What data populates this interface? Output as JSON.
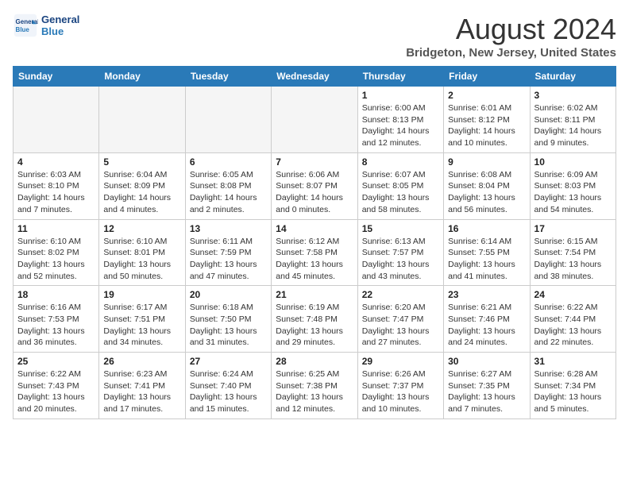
{
  "header": {
    "logo_line1": "General",
    "logo_line2": "Blue",
    "month_title": "August 2024",
    "location": "Bridgeton, New Jersey, United States"
  },
  "calendar": {
    "days_of_week": [
      "Sunday",
      "Monday",
      "Tuesday",
      "Wednesday",
      "Thursday",
      "Friday",
      "Saturday"
    ],
    "weeks": [
      [
        {
          "day": "",
          "info": ""
        },
        {
          "day": "",
          "info": ""
        },
        {
          "day": "",
          "info": ""
        },
        {
          "day": "",
          "info": ""
        },
        {
          "day": "1",
          "info": "Sunrise: 6:00 AM\nSunset: 8:13 PM\nDaylight: 14 hours\nand 12 minutes."
        },
        {
          "day": "2",
          "info": "Sunrise: 6:01 AM\nSunset: 8:12 PM\nDaylight: 14 hours\nand 10 minutes."
        },
        {
          "day": "3",
          "info": "Sunrise: 6:02 AM\nSunset: 8:11 PM\nDaylight: 14 hours\nand 9 minutes."
        }
      ],
      [
        {
          "day": "4",
          "info": "Sunrise: 6:03 AM\nSunset: 8:10 PM\nDaylight: 14 hours\nand 7 minutes."
        },
        {
          "day": "5",
          "info": "Sunrise: 6:04 AM\nSunset: 8:09 PM\nDaylight: 14 hours\nand 4 minutes."
        },
        {
          "day": "6",
          "info": "Sunrise: 6:05 AM\nSunset: 8:08 PM\nDaylight: 14 hours\nand 2 minutes."
        },
        {
          "day": "7",
          "info": "Sunrise: 6:06 AM\nSunset: 8:07 PM\nDaylight: 14 hours\nand 0 minutes."
        },
        {
          "day": "8",
          "info": "Sunrise: 6:07 AM\nSunset: 8:05 PM\nDaylight: 13 hours\nand 58 minutes."
        },
        {
          "day": "9",
          "info": "Sunrise: 6:08 AM\nSunset: 8:04 PM\nDaylight: 13 hours\nand 56 minutes."
        },
        {
          "day": "10",
          "info": "Sunrise: 6:09 AM\nSunset: 8:03 PM\nDaylight: 13 hours\nand 54 minutes."
        }
      ],
      [
        {
          "day": "11",
          "info": "Sunrise: 6:10 AM\nSunset: 8:02 PM\nDaylight: 13 hours\nand 52 minutes."
        },
        {
          "day": "12",
          "info": "Sunrise: 6:10 AM\nSunset: 8:01 PM\nDaylight: 13 hours\nand 50 minutes."
        },
        {
          "day": "13",
          "info": "Sunrise: 6:11 AM\nSunset: 7:59 PM\nDaylight: 13 hours\nand 47 minutes."
        },
        {
          "day": "14",
          "info": "Sunrise: 6:12 AM\nSunset: 7:58 PM\nDaylight: 13 hours\nand 45 minutes."
        },
        {
          "day": "15",
          "info": "Sunrise: 6:13 AM\nSunset: 7:57 PM\nDaylight: 13 hours\nand 43 minutes."
        },
        {
          "day": "16",
          "info": "Sunrise: 6:14 AM\nSunset: 7:55 PM\nDaylight: 13 hours\nand 41 minutes."
        },
        {
          "day": "17",
          "info": "Sunrise: 6:15 AM\nSunset: 7:54 PM\nDaylight: 13 hours\nand 38 minutes."
        }
      ],
      [
        {
          "day": "18",
          "info": "Sunrise: 6:16 AM\nSunset: 7:53 PM\nDaylight: 13 hours\nand 36 minutes."
        },
        {
          "day": "19",
          "info": "Sunrise: 6:17 AM\nSunset: 7:51 PM\nDaylight: 13 hours\nand 34 minutes."
        },
        {
          "day": "20",
          "info": "Sunrise: 6:18 AM\nSunset: 7:50 PM\nDaylight: 13 hours\nand 31 minutes."
        },
        {
          "day": "21",
          "info": "Sunrise: 6:19 AM\nSunset: 7:48 PM\nDaylight: 13 hours\nand 29 minutes."
        },
        {
          "day": "22",
          "info": "Sunrise: 6:20 AM\nSunset: 7:47 PM\nDaylight: 13 hours\nand 27 minutes."
        },
        {
          "day": "23",
          "info": "Sunrise: 6:21 AM\nSunset: 7:46 PM\nDaylight: 13 hours\nand 24 minutes."
        },
        {
          "day": "24",
          "info": "Sunrise: 6:22 AM\nSunset: 7:44 PM\nDaylight: 13 hours\nand 22 minutes."
        }
      ],
      [
        {
          "day": "25",
          "info": "Sunrise: 6:22 AM\nSunset: 7:43 PM\nDaylight: 13 hours\nand 20 minutes."
        },
        {
          "day": "26",
          "info": "Sunrise: 6:23 AM\nSunset: 7:41 PM\nDaylight: 13 hours\nand 17 minutes."
        },
        {
          "day": "27",
          "info": "Sunrise: 6:24 AM\nSunset: 7:40 PM\nDaylight: 13 hours\nand 15 minutes."
        },
        {
          "day": "28",
          "info": "Sunrise: 6:25 AM\nSunset: 7:38 PM\nDaylight: 13 hours\nand 12 minutes."
        },
        {
          "day": "29",
          "info": "Sunrise: 6:26 AM\nSunset: 7:37 PM\nDaylight: 13 hours\nand 10 minutes."
        },
        {
          "day": "30",
          "info": "Sunrise: 6:27 AM\nSunset: 7:35 PM\nDaylight: 13 hours\nand 7 minutes."
        },
        {
          "day": "31",
          "info": "Sunrise: 6:28 AM\nSunset: 7:34 PM\nDaylight: 13 hours\nand 5 minutes."
        }
      ]
    ]
  }
}
